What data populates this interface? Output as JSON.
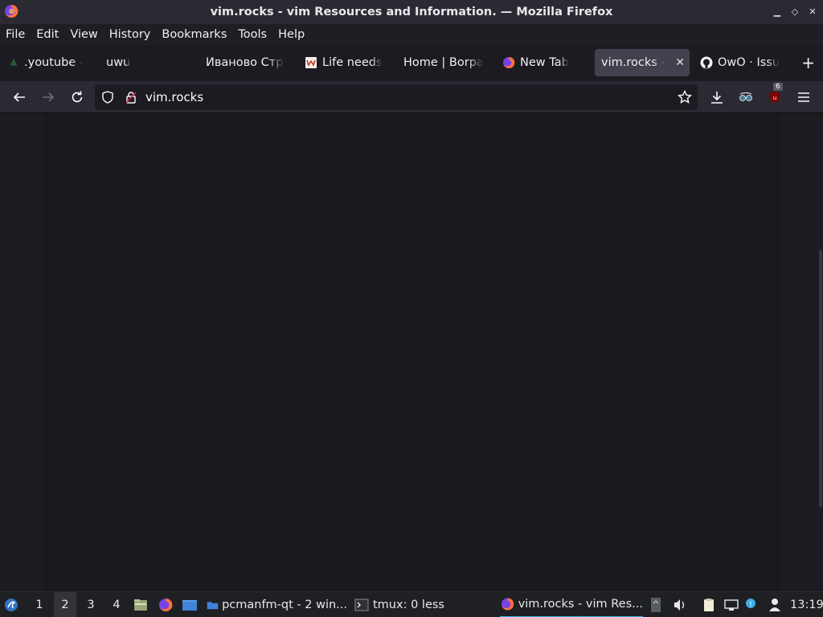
{
  "window": {
    "title": "vim.rocks - vim Resources and Information. — Mozilla Firefox",
    "controls": [
      "minimize",
      "maximize",
      "close"
    ]
  },
  "menu": [
    "File",
    "Edit",
    "View",
    "History",
    "Bookmarks",
    "Tools",
    "Help"
  ],
  "tabs": [
    {
      "label": ".youtube -",
      "icon": "youtube-favicon",
      "active": false
    },
    {
      "label": "uwu",
      "icon": "none",
      "active": false
    },
    {
      "label": "Иваново Стро",
      "icon": "none",
      "active": false
    },
    {
      "label": "Life needs",
      "icon": "life-favicon",
      "active": false
    },
    {
      "label": "Home | Borpa",
      "icon": "none",
      "active": false
    },
    {
      "label": "New Tab",
      "icon": "firefox-favicon",
      "active": false
    },
    {
      "label": "vim.rocks -",
      "icon": "none",
      "active": true
    },
    {
      "label": "OwO · Issu",
      "icon": "github-favicon",
      "active": false
    }
  ],
  "navbar": {
    "url": "vim.rocks",
    "extension_badge": "6"
  },
  "taskbar": {
    "workspaces": [
      "1",
      "2",
      "3",
      "4"
    ],
    "current_workspace": "2",
    "tasks": [
      {
        "label": "pcmanfm-qt - 2 win...",
        "icon": "folder-icon",
        "active": false
      },
      {
        "label": "tmux: 0 less",
        "icon": "terminal-icon",
        "active": false
      },
      {
        "label": "vim.rocks - vim Res...",
        "icon": "firefox-icon",
        "active": true
      }
    ],
    "clock": "13:19"
  },
  "colors": {
    "titlebar": "#2b2a33",
    "page_bg": "#1c1b22",
    "active_tab": "#42414d",
    "taskbar_accent": "#3daee9"
  }
}
